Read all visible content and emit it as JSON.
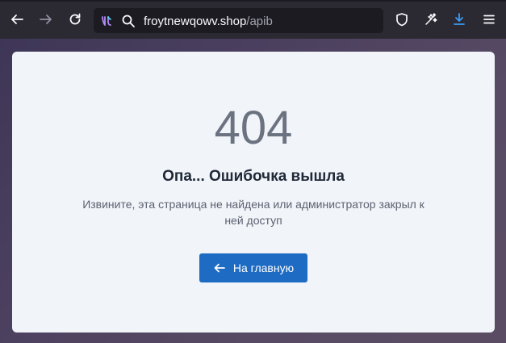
{
  "browser": {
    "url_domain": "froytnewqowv.shop",
    "url_path": "/apib",
    "icons": {
      "back": "arrow-left-icon",
      "forward": "arrow-right-icon",
      "reload": "reload-icon",
      "site": "site-identity-icon",
      "search": "search-icon",
      "shield": "shield-icon",
      "extensions": "extensions-icon",
      "downloads": "download-icon",
      "menu": "hamburger-menu-icon"
    },
    "accent_color": "#3a9cf5"
  },
  "page": {
    "error_code": "404",
    "title": "Опа... Ошибочка вышла",
    "message": "Извините, эта страница не найдена или администратор закрыл к ней доступ",
    "home_button_label": "На главную",
    "button_color": "#1e6bc4"
  }
}
